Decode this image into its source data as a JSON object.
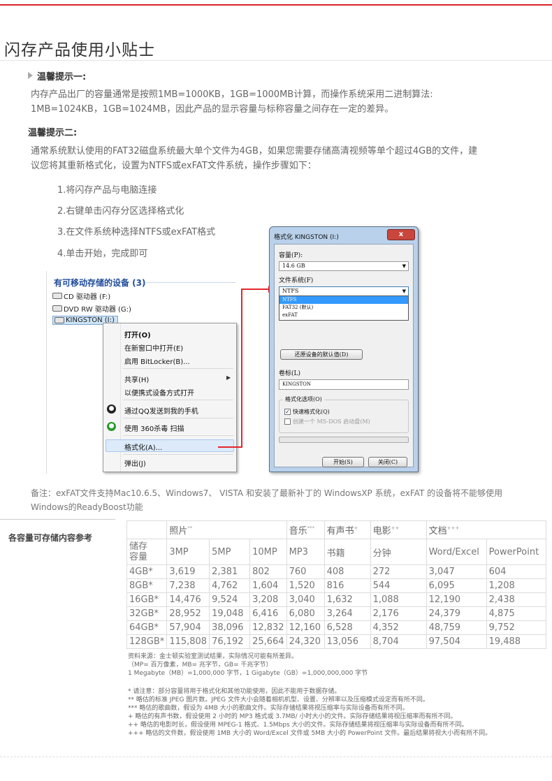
{
  "title": "闪存产品使用小贴士",
  "tip1": {
    "head": "温馨提示一:",
    "lines": [
      "内存产品出厂的容量通常是按照1MB=1000KB，1GB=1000MB计算，而操作系统采用二进制算法:",
      "1MB=1024KB，1GB=1024MB，因此产品的显示容量与标称容量之间存在一定的差异。"
    ]
  },
  "tip2": {
    "head": "温馨提示二:",
    "lines": [
      "通常系统默认使用的FAT32磁盘系统最大单个文件为4GB，如果您需要存储高清视频等单个超过4GB的文件，建",
      "议您将其重新格式化，设置为NTFS或exFAT文件系统，操作步骤如下："
    ],
    "steps": [
      "1.将闪存产品与电脑连接",
      "2.右键单击闪存分区选择格式化",
      "3.在文件系统种选择NTFS或exFAT格式",
      "4.单击开始，完成即可"
    ]
  },
  "explorer": {
    "header": "有可移动存储的设备 (3)",
    "drives": [
      "CD 驱动器 (F:)",
      "DVD RW 驱动器 (G:)",
      "KINGSTON (I:)"
    ],
    "menu": [
      "打开(O)",
      "在新窗口中打开(E)",
      "启用 BitLocker(B)...",
      "共享(H)",
      "以便携式设备方式打开",
      "通过QQ发送到我的手机",
      "使用 360杀毒 扫描",
      "格式化(A)...",
      "弹出(J)"
    ]
  },
  "dialog": {
    "title": "格式化 KINGSTON (I:)",
    "close": "x",
    "capacity_label": "容量(P):",
    "capacity_value": "14.6 GB",
    "fs_label": "文件系统(F)",
    "fs_value": "NTFS",
    "fs_options": [
      "NTFS",
      "FAT32 (默认)",
      "exFAT"
    ],
    "restore_button": "还原设备的默认值(D)",
    "volume_label": "卷标(L)",
    "volume_value": "KINGSTON",
    "options_label": "格式化选项(O)",
    "quick_format": "快速格式化(Q)",
    "msdos_disk": "创建一个 MS-DOS 启动盘(M)",
    "start_button": "开始(S)",
    "close_button": "关闭(C)"
  },
  "note": [
    "备注：exFAT文件支持Mac10.6.5、Windows7、  VISTA  和安装了最新补丁的 WindowsXP 系统，exFAT 的设备将不能够使用",
    "Windows的ReadyBoost功能"
  ],
  "table": {
    "section_label": "各容量可存储内容参考",
    "groups": [
      {
        "label": "照片",
        "mark": "**"
      },
      {
        "label": "音乐",
        "mark": "***"
      },
      {
        "label": "有声书",
        "mark": "+"
      },
      {
        "label": "电影",
        "mark": "++"
      },
      {
        "label": "文档",
        "mark": "+++"
      }
    ],
    "capacity_head": [
      "储存",
      "容量"
    ],
    "subheads": [
      "3MP",
      "5MP",
      "10MP",
      "MP3",
      "书籍",
      "分钟",
      "Word/Excel",
      "PowerPoint"
    ],
    "rows": [
      [
        "4GB*",
        "3,619",
        "2,381",
        "802",
        "760",
        "408",
        "272",
        "3,047",
        "604"
      ],
      [
        "8GB*",
        "7,238",
        "4,762",
        "1,604",
        "1,520",
        "816",
        "544",
        "6,095",
        "1,208"
      ],
      [
        "16GB*",
        "14,476",
        "9,524",
        "3,208",
        "3,040",
        "1,632",
        "1,088",
        "12,190",
        "2,438"
      ],
      [
        "32GB*",
        "28,952",
        "19,048",
        "6,416",
        "6,080",
        "3,264",
        "2,176",
        "24,379",
        "4,875"
      ],
      [
        "64GB*",
        "57,904",
        "38,096",
        "12,832",
        "12,160",
        "6,528",
        "4,352",
        "48,759",
        "9,752"
      ],
      [
        "128GB*",
        "115,808",
        "76,192",
        "25,664",
        "24,320",
        "13,056",
        "8,704",
        "97,504",
        "19,488"
      ]
    ]
  },
  "sources": [
    "资料来源：金士顿实验室测试结果，实际情况可能有所差异。",
    "（MP= 百万像素，MB= 兆字节，GB= 千兆字节）",
    "1 Megabyte（MB）=1,000,000 字节，1 Gigabyte（GB）=1,000,000,000 字节"
  ],
  "footnotes": [
    "* 请注意：部分容量将用于格式化和其他功能使用，因此不能用于数据存储。",
    "** 略估的标准 JPEG 图片数。JPEG 文件大小会随着相机机型、设置、分辨率以及压缩模式设定而有所不同。",
    "*** 略估的歌曲数，假设为 4MB 大小的歌曲文件。实际存储结果将视压缩率与实际设备而有所不同。",
    "+ 略估的有声书数，假设使用 2 小时的 MP3 格式或 3.7MB/ 小时大小的文件。实际存储结果将视压缩率而有所不同。",
    "++ 略估的电影时长，假设使用 MPEG-1 格式、1.5Mbps 大小的文件。实际存储结果将视压缩率与实际设备而有所不同。",
    "+++ 略估的文件数，假设使用 1MB 大小的 Word/Excel 文件或 5MB 大小的 PowerPoint 文件。最后结果将视大小而有所不同。"
  ],
  "colors": {
    "accent": "#d9222a",
    "link_blue": "#1e4b9a"
  }
}
